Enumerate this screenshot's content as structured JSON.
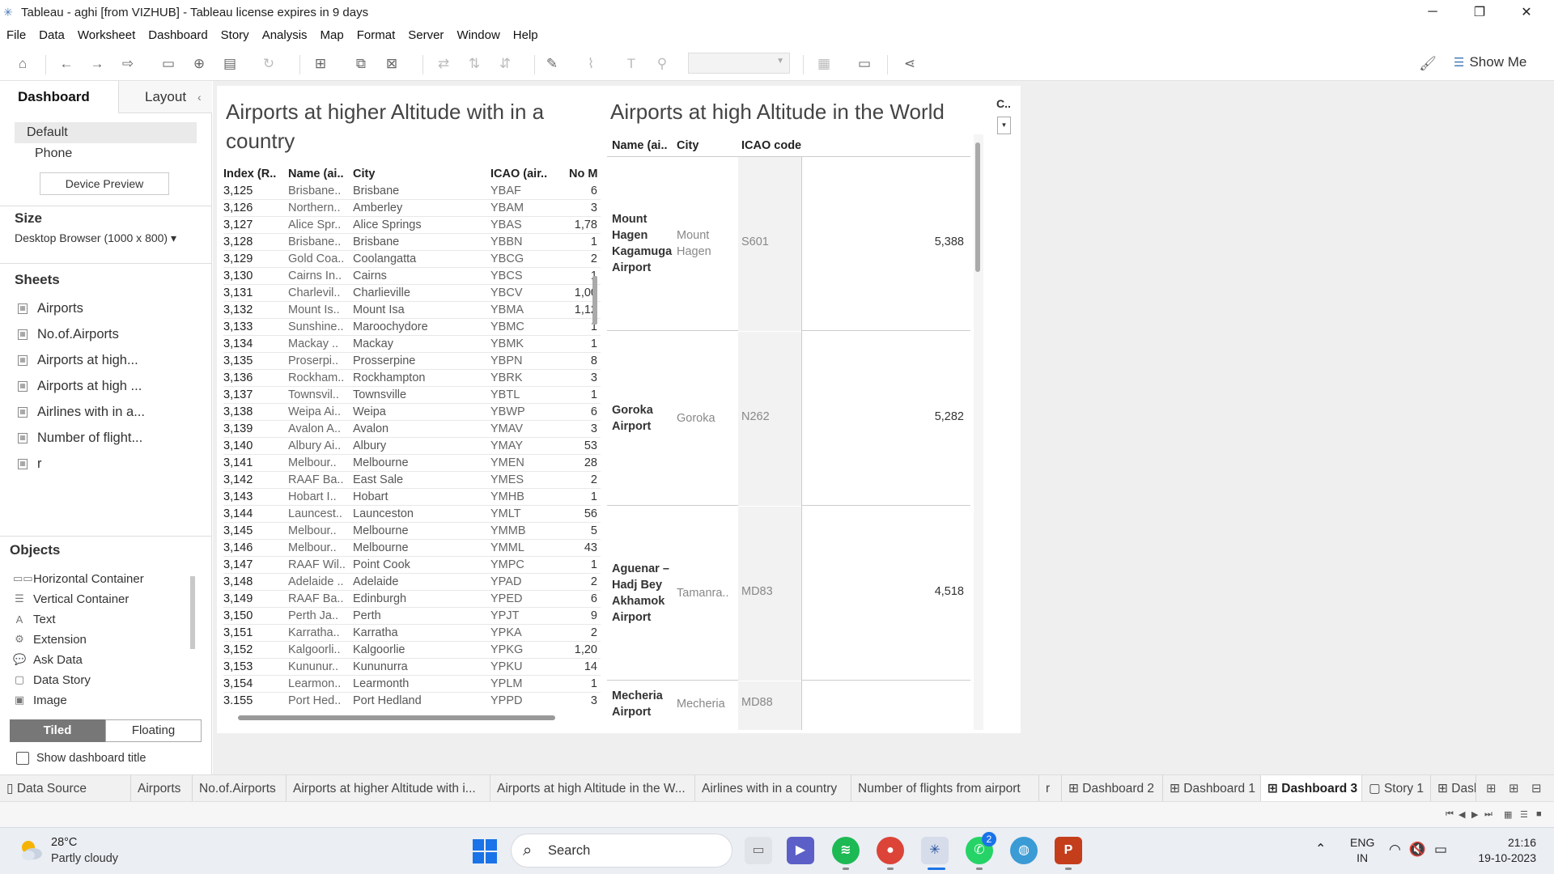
{
  "window": {
    "title": "Tableau - aghi [from VIZHUB] - Tableau license expires in 9 days",
    "controls": [
      "─",
      "❐",
      "✕"
    ]
  },
  "menu": [
    "File",
    "Data",
    "Worksheet",
    "Dashboard",
    "Story",
    "Analysis",
    "Map",
    "Format",
    "Server",
    "Window",
    "Help"
  ],
  "toolbar": {
    "icons": [
      "home-icon",
      "undo-icon",
      "redo-icon",
      "replay-icon",
      "save-icon",
      "new-data-source-icon",
      "pause-auto-updates-icon",
      "refresh-icon",
      "new-worksheet-icon",
      "duplicate-sheet-icon",
      "clear-sheet-icon",
      "swap-icon",
      "sort-ascending-icon",
      "sort-descending-icon",
      "highlight-icon",
      "group-icon",
      "label-icon",
      "pin-icon",
      "fit-combo",
      "show-cards-icon",
      "presentation-icon",
      "share-icon",
      "format-painter-icon"
    ],
    "show_me_label": "Show Me"
  },
  "left_pane": {
    "tabs": {
      "dashboard": "Dashboard",
      "layout": "Layout"
    },
    "devices": {
      "default": "Default",
      "phone": "Phone"
    },
    "device_preview_label": "Device Preview",
    "size_heading": "Size",
    "size_value": "Desktop Browser (1000 x 800)",
    "sheets_heading": "Sheets",
    "sheets": [
      "Airports",
      "No.of.Airports",
      "Airports at high...",
      "Airports at high ...",
      "Airlines with in a...",
      "Number of flight...",
      "r"
    ],
    "objects_heading": "Objects",
    "objects": [
      {
        "icon": "horizontal-container-icon",
        "glyph": "▭▭",
        "label": "Horizontal Container"
      },
      {
        "icon": "vertical-container-icon",
        "glyph": "☰",
        "label": "Vertical Container"
      },
      {
        "icon": "text-icon",
        "glyph": "A",
        "label": "Text"
      },
      {
        "icon": "extension-icon",
        "glyph": "⚙",
        "label": "Extension"
      },
      {
        "icon": "ask-data-icon",
        "glyph": "💬",
        "label": "Ask Data"
      },
      {
        "icon": "data-story-icon",
        "glyph": "▢",
        "label": "Data Story"
      },
      {
        "icon": "image-icon",
        "glyph": "▣",
        "label": "Image"
      }
    ],
    "tiled_label": "Tiled",
    "floating_label": "Floating",
    "show_title_label": "Show dashboard title"
  },
  "sheet1": {
    "title": "Airports at higher Altitude with in a country",
    "headers": {
      "index": "Index (R..",
      "name": "Name (ai..",
      "city": "City",
      "icao": "ICAO (air..",
      "no": "No M"
    },
    "rows": [
      [
        "3,125",
        "Brisbane..",
        "Brisbane",
        "YBAF",
        "6"
      ],
      [
        "3,126",
        "Northern..",
        "Amberley",
        "YBAM",
        "3"
      ],
      [
        "3,127",
        "Alice Spr..",
        "Alice Springs",
        "YBAS",
        "1,78"
      ],
      [
        "3,128",
        "Brisbane..",
        "Brisbane",
        "YBBN",
        "1"
      ],
      [
        "3,129",
        "Gold Coa..",
        "Coolangatta",
        "YBCG",
        "2"
      ],
      [
        "3,130",
        "Cairns In..",
        "Cairns",
        "YBCS",
        "1"
      ],
      [
        "3,131",
        "Charlevil..",
        "Charlieville",
        "YBCV",
        "1,00"
      ],
      [
        "3,132",
        "Mount Is..",
        "Mount Isa",
        "YBMA",
        "1,12"
      ],
      [
        "3,133",
        "Sunshine..",
        "Maroochydore",
        "YBMC",
        "1"
      ],
      [
        "3,134",
        "Mackay ..",
        "Mackay",
        "YBMK",
        "1"
      ],
      [
        "3,135",
        "Proserpi..",
        "Prosserpine",
        "YBPN",
        "8"
      ],
      [
        "3,136",
        "Rockham..",
        "Rockhampton",
        "YBRK",
        "3"
      ],
      [
        "3,137",
        "Townsvil..",
        "Townsville",
        "YBTL",
        "1"
      ],
      [
        "3,138",
        "Weipa Ai..",
        "Weipa",
        "YBWP",
        "6"
      ],
      [
        "3,139",
        "Avalon A..",
        "Avalon",
        "YMAV",
        "3"
      ],
      [
        "3,140",
        "Albury Ai..",
        "Albury",
        "YMAY",
        "53"
      ],
      [
        "3,141",
        "Melbour..",
        "Melbourne",
        "YMEN",
        "28"
      ],
      [
        "3,142",
        "RAAF Ba..",
        "East Sale",
        "YMES",
        "2"
      ],
      [
        "3,143",
        "Hobart I..",
        "Hobart",
        "YMHB",
        "1"
      ],
      [
        "3,144",
        "Launcest..",
        "Launceston",
        "YMLT",
        "56"
      ],
      [
        "3,145",
        "Melbour..",
        "Melbourne",
        "YMMB",
        "5"
      ],
      [
        "3,146",
        "Melbour..",
        "Melbourne",
        "YMML",
        "43"
      ],
      [
        "3,147",
        "RAAF Wil..",
        "Point Cook",
        "YMPC",
        "1"
      ],
      [
        "3,148",
        "Adelaide ..",
        "Adelaide",
        "YPAD",
        "2"
      ],
      [
        "3,149",
        "RAAF Ba..",
        "Edinburgh",
        "YPED",
        "6"
      ],
      [
        "3,150",
        "Perth Ja..",
        "Perth",
        "YPJT",
        "9"
      ],
      [
        "3,151",
        "Karratha..",
        "Karratha",
        "YPKA",
        "2"
      ],
      [
        "3,152",
        "Kalgoorli..",
        "Kalgoorlie",
        "YPKG",
        "1,20"
      ],
      [
        "3,153",
        "Kununur..",
        "Kununurra",
        "YPKU",
        "14"
      ],
      [
        "3,154",
        "Learmon..",
        "Learmonth",
        "YPLM",
        "1"
      ],
      [
        "3,155",
        "Port Hed..",
        "Port Hedland",
        "YPPD",
        "3"
      ]
    ]
  },
  "sheet2": {
    "title": "Airports at high Altitude in the World",
    "headers": {
      "name": "Name (ai..",
      "city": "City",
      "icao": "ICAO code"
    },
    "rows": [
      {
        "name": "Mount Hagen Kagamuga Airport",
        "city": "Mount Hagen",
        "icao": "S601",
        "alt": "5,388"
      },
      {
        "name": "Goroka Airport",
        "city": "Goroka",
        "icao": "N262",
        "alt": "5,282"
      },
      {
        "name": "Aguenar – Hadj Bey Akhamok Airport",
        "city": "Tamanra..",
        "icao": "MD83",
        "alt": "4,518"
      },
      {
        "name": "Mecheria Airport",
        "city": "Mecheria",
        "icao": "MD88",
        "alt": ""
      }
    ]
  },
  "filter_card": {
    "title": "C.."
  },
  "sheet_tabs": [
    {
      "label": "Data Source",
      "icon": "data-source-icon"
    },
    {
      "label": "Airports"
    },
    {
      "label": "No.of.Airports"
    },
    {
      "label": "Airports at higher Altitude with i..."
    },
    {
      "label": "Airports at high Altitude in the W..."
    },
    {
      "label": "Airlines with in a country"
    },
    {
      "label": "Number of flights from airport"
    },
    {
      "label": "r"
    },
    {
      "label": "Dashboard 2",
      "icon": "dashboard-icon"
    },
    {
      "label": "Dashboard 1",
      "icon": "dashboard-icon"
    },
    {
      "label": "Dashboard 3",
      "icon": "dashboard-icon",
      "active": true
    },
    {
      "label": "Story 1",
      "icon": "story-icon"
    },
    {
      "label": "Dashb",
      "icon": "dashboard-icon"
    }
  ],
  "taskbar": {
    "weather_temp": "28°C",
    "weather_desc": "Partly cloudy",
    "search_label": "Search",
    "lang_line1": "ENG",
    "lang_line2": "IN",
    "time": "21:16",
    "date": "19-10-2023",
    "whatsapp_badge": "2"
  },
  "colors": {
    "accent": "#1f77b4",
    "tableau_blue": "#4a7bb7",
    "active_tab": "#ffffff"
  }
}
